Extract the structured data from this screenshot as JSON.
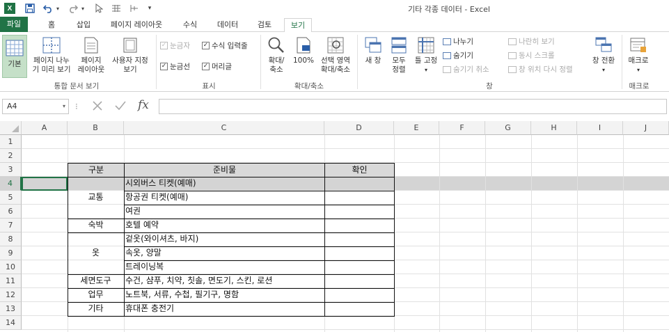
{
  "window": {
    "title": "기타 각종 데이터 - Excel",
    "app_logo": "X"
  },
  "quick_access": {
    "save_icon": "save-icon",
    "undo_icon": "undo-icon",
    "redo_icon": "redo-icon"
  },
  "tabs": [
    "파일",
    "홈",
    "삽입",
    "페이지 레이아웃",
    "수식",
    "데이터",
    "검토",
    "보기"
  ],
  "ribbon": {
    "workbook_views": {
      "normal": "기본",
      "page_break_line1": "페이지 나누",
      "page_break_line2": "기 미리 보기",
      "page_layout_line1": "페이지",
      "page_layout_line2": "레이아웃",
      "custom_views_line1": "사용자 지정",
      "custom_views_line2": "보기",
      "label": "통합 문서 보기"
    },
    "show": {
      "ruler": "눈금자",
      "formula_bar": "수식 입력줄",
      "gridlines": "눈금선",
      "headings": "머리글",
      "label": "표시"
    },
    "zoom": {
      "zoom_line1": "확대/",
      "zoom_line2": "축소",
      "hundred": "100%",
      "zoom_sel_line1": "선택 영역",
      "zoom_sel_line2": "확대/축소",
      "label": "확대/축소"
    },
    "window": {
      "new_window": "새 창",
      "arrange_all_line1": "모두",
      "arrange_all_line2": "정렬",
      "freeze": "틀 고정",
      "split": "나누기",
      "hide": "숨기기",
      "unhide": "숨기기 취소",
      "side_by_side": "나란히 보기",
      "sync_scroll": "동시 스크롤",
      "reset_pos": "창 위치 다시 정렬",
      "switch": "창 전환",
      "label": "창"
    },
    "macros": {
      "macro": "매크로",
      "label": "매크로"
    }
  },
  "formula_bar": {
    "name_box": "A4",
    "fx": "fx",
    "value": ""
  },
  "columns": [
    "A",
    "B",
    "C",
    "D",
    "E",
    "F",
    "G",
    "H",
    "I",
    "J"
  ],
  "rows": [
    "1",
    "2",
    "3",
    "4",
    "5",
    "6",
    "7",
    "8",
    "9",
    "10",
    "11",
    "12",
    "13",
    "14"
  ],
  "table": {
    "headers": {
      "category": "구분",
      "item": "준비물",
      "check": "확인"
    },
    "groups": {
      "transport": "교통",
      "lodging": "숙박",
      "clothes": "옷",
      "toiletries": "세면도구",
      "work": "업무",
      "misc": "기타"
    },
    "items": [
      "시외버스 티켓(예매)",
      "항공권 티켓(예매)",
      "여권",
      "호텔 예약",
      "겉옷(와이셔츠, 바지)",
      "속옷, 양말",
      "트레이닝복",
      "수건, 샴푸, 치약, 칫솔, 면도기, 스킨, 로션",
      "노트북, 서류, 수첩, 필기구, 명함",
      "휴대폰 충전기"
    ]
  },
  "colors": {
    "excel_green": "#217346",
    "header_fill": "#d9d9d9",
    "selected_row": "#d4d4d4"
  }
}
